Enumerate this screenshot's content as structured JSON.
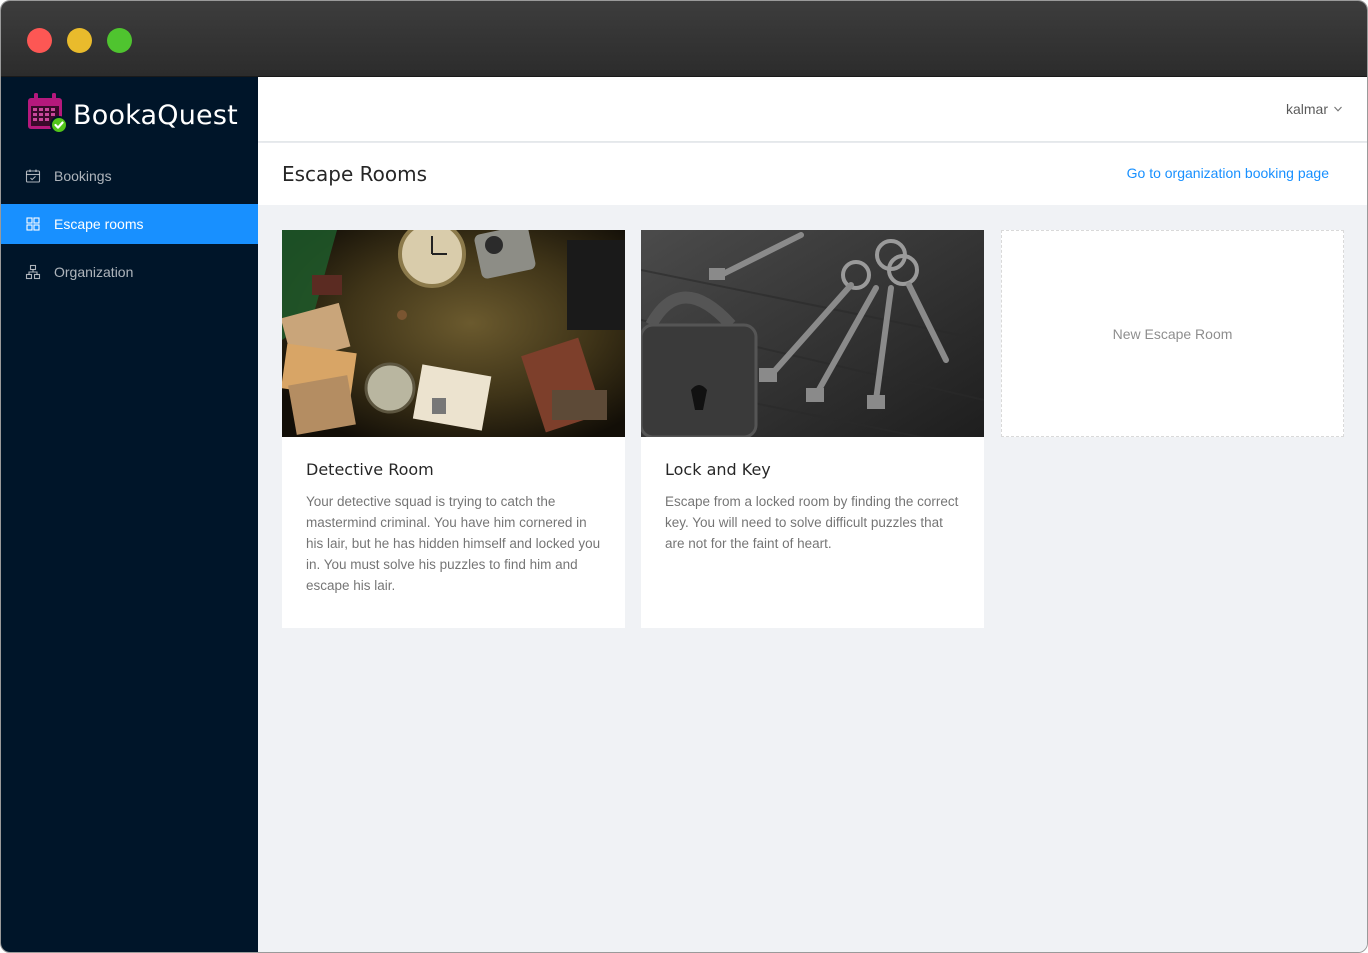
{
  "brand": {
    "name": "BookaQuest",
    "logo_icon": "calendar-check-icon",
    "accent": "#b5197c",
    "check_color": "#52c41a"
  },
  "sidebar": {
    "items": [
      {
        "label": "Bookings",
        "icon": "calendar-icon",
        "active": false
      },
      {
        "label": "Escape rooms",
        "icon": "grid-icon",
        "active": true
      },
      {
        "label": "Organization",
        "icon": "org-chart-icon",
        "active": false
      }
    ]
  },
  "topbar": {
    "user_name": "kalmar"
  },
  "page": {
    "title": "Escape Rooms",
    "org_link_label": "Go to organization booking page"
  },
  "rooms": [
    {
      "name": "Detective Room",
      "description": "Your detective squad is trying to catch the mastermind criminal. You have him cornered in his lair, but he has hidden himself and locked you in. You must solve his puzzles to find him and escape his lair."
    },
    {
      "name": "Lock and Key",
      "description": "Escape from a locked room by finding the correct key. You will need to solve difficult puzzles that are not for the faint of heart."
    }
  ],
  "new_room_label": "New Escape Room",
  "colors": {
    "sidebar_bg": "#001529",
    "active": "#1890ff",
    "link": "#1890ff"
  }
}
